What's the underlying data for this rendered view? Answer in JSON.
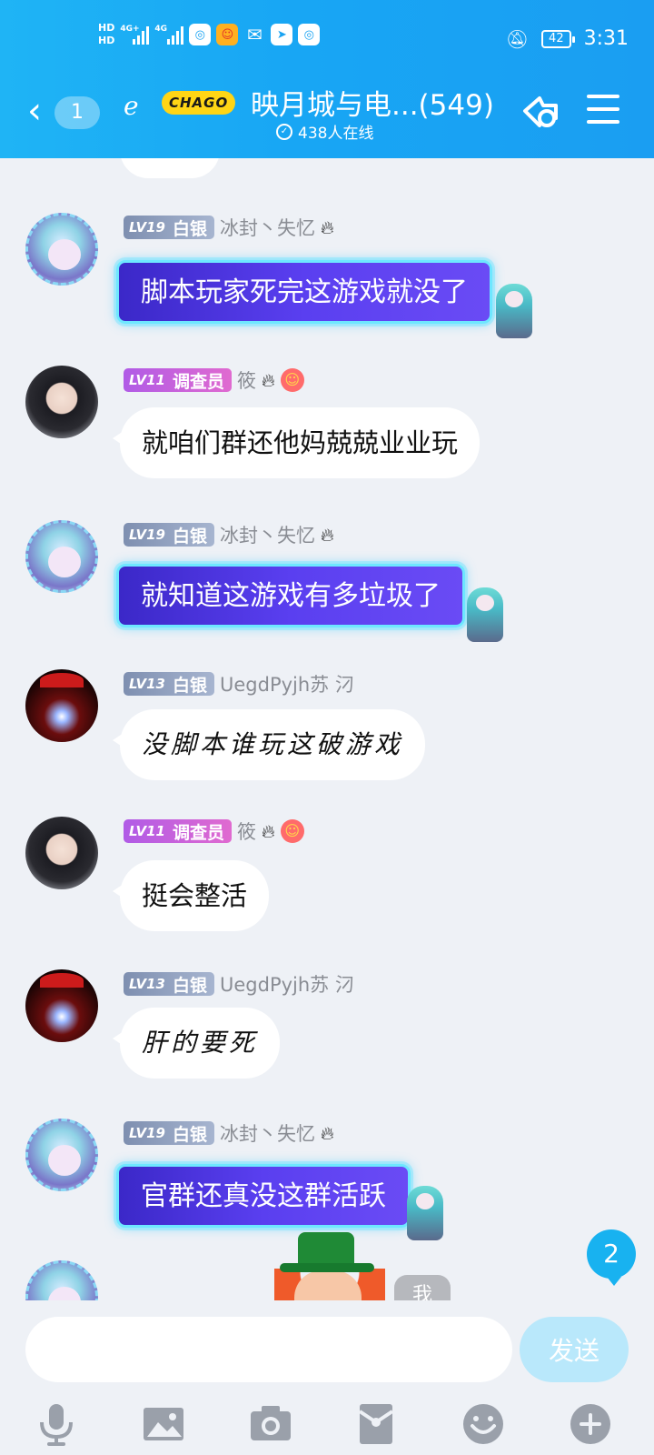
{
  "status_bar": {
    "hd1": "HD",
    "hd2": "HD",
    "net1": "4G+",
    "net2": "4G",
    "time": "3:31",
    "battery": "42"
  },
  "header": {
    "back_count": "1",
    "badge": "CHAGO",
    "group_title": "映月城与电...(549)",
    "online_text": "438人在线"
  },
  "messages": [
    {
      "level": "LV19",
      "title": "白银",
      "nick": "冰封丶失忆",
      "text": "脚本玩家死完这游戏就没了",
      "style": "miku"
    },
    {
      "level": "LV11",
      "title": "调查员",
      "nick": "筱",
      "text": "就咱们群还他妈兢兢业业玩",
      "style": "plain"
    },
    {
      "level": "LV19",
      "title": "白银",
      "nick": "冰封丶失忆",
      "text": "就知道这游戏有多垃圾了",
      "style": "miku"
    },
    {
      "level": "LV13",
      "title": "白银",
      "nick": "UegdPyjh苏 汈",
      "text": "没脚本谁玩这破游戏",
      "style": "hand"
    },
    {
      "level": "LV11",
      "title": "调查员",
      "nick": "筱",
      "text": "挺会整活",
      "style": "plain"
    },
    {
      "level": "LV13",
      "title": "白银",
      "nick": "UegdPyjh苏 汈",
      "text": "肝的要死",
      "style": "hand"
    },
    {
      "level": "LV19",
      "title": "白银",
      "nick": "冰封丶失忆",
      "text": "官群还真没这群活跃",
      "style": "miku"
    }
  ],
  "overlays": {
    "unread_count": "2",
    "me_label": "我"
  },
  "input": {
    "value": "",
    "placeholder": "",
    "send_label": "发送"
  },
  "toolbar": {
    "icons": [
      "microphone-icon",
      "image-icon",
      "camera-icon",
      "red-packet-icon",
      "emoji-icon",
      "plus-icon"
    ]
  },
  "colors": {
    "header": "#1aa6f3",
    "miku_bubble": "#4f36e6",
    "send_button": "#b9e8fb",
    "unread_badge": "#18b2f0"
  }
}
